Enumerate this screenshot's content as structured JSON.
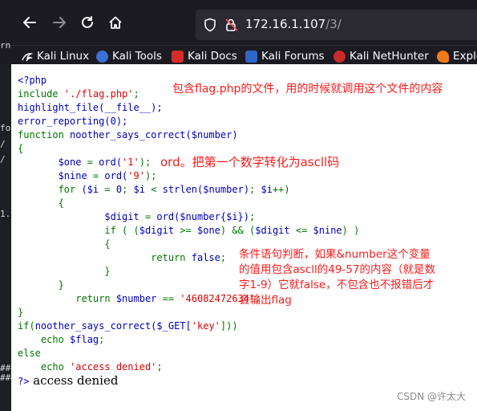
{
  "browser": {
    "url_host": "172.16.1.107",
    "url_path": "/3/"
  },
  "bookmarks": [
    {
      "label": "Kali Linux",
      "icon": "kali-dragon-icon"
    },
    {
      "label": "Kali Tools",
      "icon": "kali-tools-icon"
    },
    {
      "label": "Kali Docs",
      "icon": "kali-docs-icon"
    },
    {
      "label": "Kali Forums",
      "icon": "kali-forums-icon"
    },
    {
      "label": "Kali NetHunter",
      "icon": "kali-nethunter-icon"
    },
    {
      "label": "Exple",
      "icon": "exploit-db-icon"
    }
  ],
  "left_strip": [
    "rn",
    "fo.",
    "/",
    "/",
    "1.j",
    "###",
    "###"
  ],
  "code": {
    "l01": "<?php",
    "l02_a": "include ",
    "l02_b": "'./flag.php'",
    "l02_c": ";",
    "l03": "highlight_file(__file__);",
    "l04": "error_reporting(0);",
    "l05_a": "function ",
    "l05_b": "noother_says_correct($number)",
    "l06": "{",
    "l07_a": "       $one ",
    "l07_b": "= ",
    "l07_c": "ord(",
    "l07_d": "'1'",
    "l07_e": ");",
    "l08_a": "       $nine ",
    "l08_b": "= ",
    "l08_c": "ord(",
    "l08_d": "'9'",
    "l08_e": ");",
    "l09_a": "       for ",
    "l09_b": "($i ",
    "l09_c": "= ",
    "l09_d": "0",
    "l09_e": "; ",
    "l09_f": "$i ",
    "l09_g": "< ",
    "l09_h": "strlen($number)",
    "l09_i": "; ",
    "l09_j": "$i",
    "l09_k": "++)",
    "l10": "       {",
    "l11_a": "               $digit ",
    "l11_b": "= ",
    "l11_c": "ord($number{$i})",
    "l11_d": ";",
    "l12_a": "               if ",
    "l12_b": "( (",
    "l12_c": "$digit ",
    "l12_d": ">= ",
    "l12_e": "$one",
    "l12_f": ") && (",
    "l12_g": "$digit ",
    "l12_h": "<= ",
    "l12_i": "$nine",
    "l12_j": ") )",
    "l13": "               {",
    "l14_a": "                       return ",
    "l14_b": "false",
    "l14_c": ";",
    "l15": "               }",
    "l16": "       }",
    "l17_a": "          return ",
    "l17_b": "$number ",
    "l17_c": "== ",
    "l17_d": "'46082472634'",
    "l17_e": ";",
    "l18": "}",
    "l19_a": "if(",
    "l19_b": "noother_says_correct($_GET[",
    "l19_c": "'key'",
    "l19_d": "]))",
    "l20_a": "    echo ",
    "l20_b": "$flag",
    "l20_c": ";",
    "l21": "else",
    "l22_a": "    echo ",
    "l22_b": "'access denied'",
    "l22_c": ";",
    "l23": "?>",
    "output": " access denied"
  },
  "annotations": {
    "a1": "包含flag.php的文件，用的时候就调用这个文件的内容",
    "a2": "ord。把第一个数字转化为ascll码",
    "a3_l1": "条件语句判断，如果&number这个变量",
    "a3_l2": "的值用包含ascll的49-57的内容（就是数",
    "a3_l3": "字1-9）它就false，不包含也不报错后才",
    "a3_l4": "会输出flag"
  },
  "watermark": "CSDN @许太大"
}
